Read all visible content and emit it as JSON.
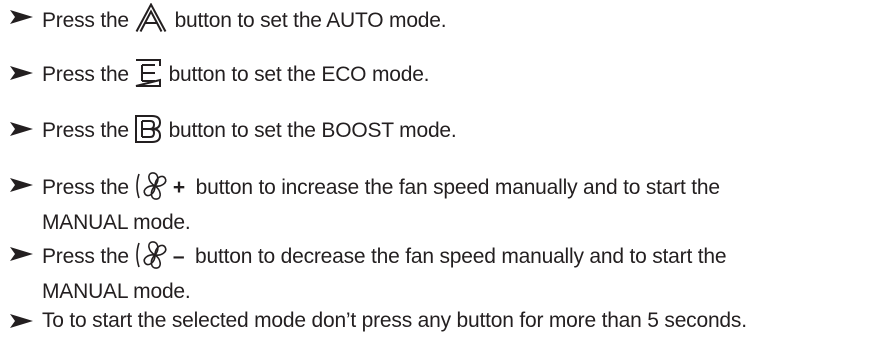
{
  "items": [
    {
      "bullet_icon": "arrowhead-bullet-icon",
      "before": "Press the",
      "icon": "auto-mode-icon",
      "after": "button to set the AUTO mode."
    },
    {
      "bullet_icon": "arrowhead-bullet-icon",
      "before": "Press the",
      "icon": "eco-mode-icon",
      "after": "button to set the ECO mode."
    },
    {
      "bullet_icon": "arrowhead-bullet-icon",
      "before": "Press the",
      "icon": "boost-mode-icon",
      "after": "button to set the BOOST mode."
    },
    {
      "bullet_icon": "arrowhead-bullet-icon",
      "before": "Press the",
      "icon": "fan-icon",
      "sign": "+",
      "after": "button to increase the fan speed manually and to start the",
      "line2": "MANUAL mode."
    },
    {
      "bullet_icon": "arrowhead-bullet-icon",
      "before": "Press the",
      "icon": "fan-icon",
      "sign": "–",
      "after": "button to decrease the fan speed manually and to start the",
      "line2": "MANUAL mode."
    },
    {
      "bullet_icon": "arrowhead-bullet-icon",
      "text": "To to start the selected mode don’t press any button for more than 5 seconds."
    }
  ]
}
